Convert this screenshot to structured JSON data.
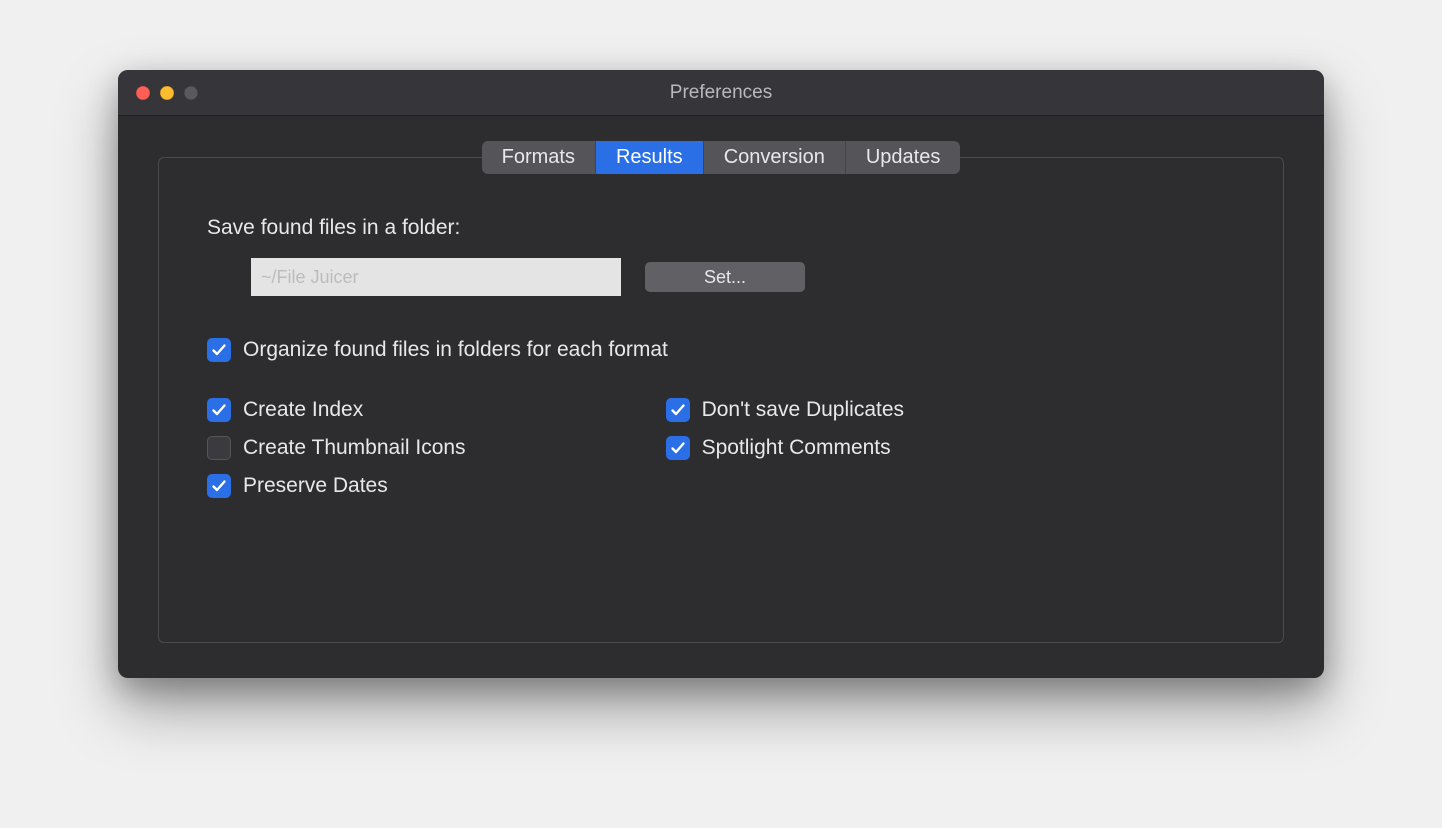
{
  "window": {
    "title": "Preferences"
  },
  "tabs": {
    "formats": "Formats",
    "results": "Results",
    "conversion": "Conversion",
    "updates": "Updates"
  },
  "folder": {
    "label": "Save found files in a folder:",
    "value": "~/File Juicer",
    "set_button": "Set..."
  },
  "checkboxes": {
    "organize": {
      "label": "Organize found files in folders for each format",
      "checked": true
    },
    "create_index": {
      "label": "Create Index",
      "checked": true
    },
    "create_thumb": {
      "label": "Create Thumbnail Icons",
      "checked": false
    },
    "preserve_dates": {
      "label": "Preserve Dates",
      "checked": true
    },
    "no_dup": {
      "label": "Don't save Duplicates",
      "checked": true
    },
    "spotlight": {
      "label": "Spotlight Comments",
      "checked": true
    }
  }
}
